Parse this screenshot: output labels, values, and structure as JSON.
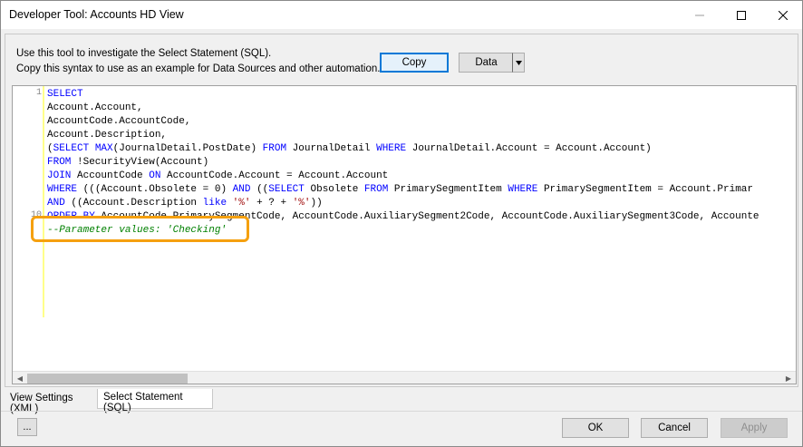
{
  "window": {
    "title": "Developer Tool:  Accounts HD View"
  },
  "info": {
    "line1": "Use this tool to investigate the Select Statement (SQL).",
    "line2": "Copy this syntax to use as an example for Data Sources and other automation."
  },
  "toolbar": {
    "copy_label": "Copy",
    "data_label": "Data"
  },
  "editor": {
    "line_numbers": [
      "1",
      "10"
    ],
    "lines": [
      [
        {
          "t": "SELECT",
          "c": "kw"
        }
      ],
      [
        {
          "t": "Account.Account,",
          "c": ""
        }
      ],
      [
        {
          "t": "AccountCode.AccountCode,",
          "c": ""
        }
      ],
      [
        {
          "t": "Account.Description,",
          "c": ""
        }
      ],
      [
        {
          "t": "(",
          "c": ""
        },
        {
          "t": "SELECT",
          "c": "kw"
        },
        {
          "t": " ",
          "c": ""
        },
        {
          "t": "MAX",
          "c": "kw"
        },
        {
          "t": "(JournalDetail.PostDate) ",
          "c": ""
        },
        {
          "t": "FROM",
          "c": "kw"
        },
        {
          "t": " JournalDetail ",
          "c": ""
        },
        {
          "t": "WHERE",
          "c": "kw"
        },
        {
          "t": " JournalDetail.Account = Account.Account)",
          "c": ""
        }
      ],
      [
        {
          "t": "FROM",
          "c": "kw"
        },
        {
          "t": " !SecurityView(Account)",
          "c": ""
        }
      ],
      [
        {
          "t": "JOIN",
          "c": "kw"
        },
        {
          "t": " AccountCode ",
          "c": ""
        },
        {
          "t": "ON",
          "c": "kw"
        },
        {
          "t": " AccountCode.Account = Account.Account",
          "c": ""
        }
      ],
      [
        {
          "t": "WHERE",
          "c": "kw"
        },
        {
          "t": " (((Account.Obsolete = 0) ",
          "c": ""
        },
        {
          "t": "AND",
          "c": "kw"
        },
        {
          "t": " ((",
          "c": ""
        },
        {
          "t": "SELECT",
          "c": "kw"
        },
        {
          "t": " Obsolete ",
          "c": ""
        },
        {
          "t": "FROM",
          "c": "kw"
        },
        {
          "t": " PrimarySegmentItem ",
          "c": ""
        },
        {
          "t": "WHERE",
          "c": "kw"
        },
        {
          "t": " PrimarySegmentItem = Account.Primar",
          "c": ""
        }
      ],
      [
        {
          "t": "AND",
          "c": "kw"
        },
        {
          "t": " ((Account.Description ",
          "c": ""
        },
        {
          "t": "like",
          "c": "kw"
        },
        {
          "t": " ",
          "c": ""
        },
        {
          "t": "'%'",
          "c": "str"
        },
        {
          "t": " + ? + ",
          "c": ""
        },
        {
          "t": "'%'",
          "c": "str"
        },
        {
          "t": "))",
          "c": ""
        }
      ],
      [
        {
          "t": "ORDER BY",
          "c": "kw"
        },
        {
          "t": " AccountCode.PrimarySegmentCode, AccountCode.AuxiliarySegment2Code, AccountCode.AuxiliarySegment3Code, Accounte",
          "c": ""
        }
      ],
      [
        {
          "t": "--Parameter values: 'Checking'",
          "c": "cmt"
        }
      ]
    ]
  },
  "tabs": [
    {
      "label": "View Settings (XML)"
    },
    {
      "label": "Select Statement (SQL)"
    }
  ],
  "footer": {
    "more_label": "...",
    "ok_label": "OK",
    "cancel_label": "Cancel",
    "apply_label": "Apply"
  },
  "colors": {
    "highlight": "#f5a00f",
    "keyword": "#0000ff",
    "comment": "#008000",
    "string": "#a31515",
    "accent": "#0078d7"
  }
}
